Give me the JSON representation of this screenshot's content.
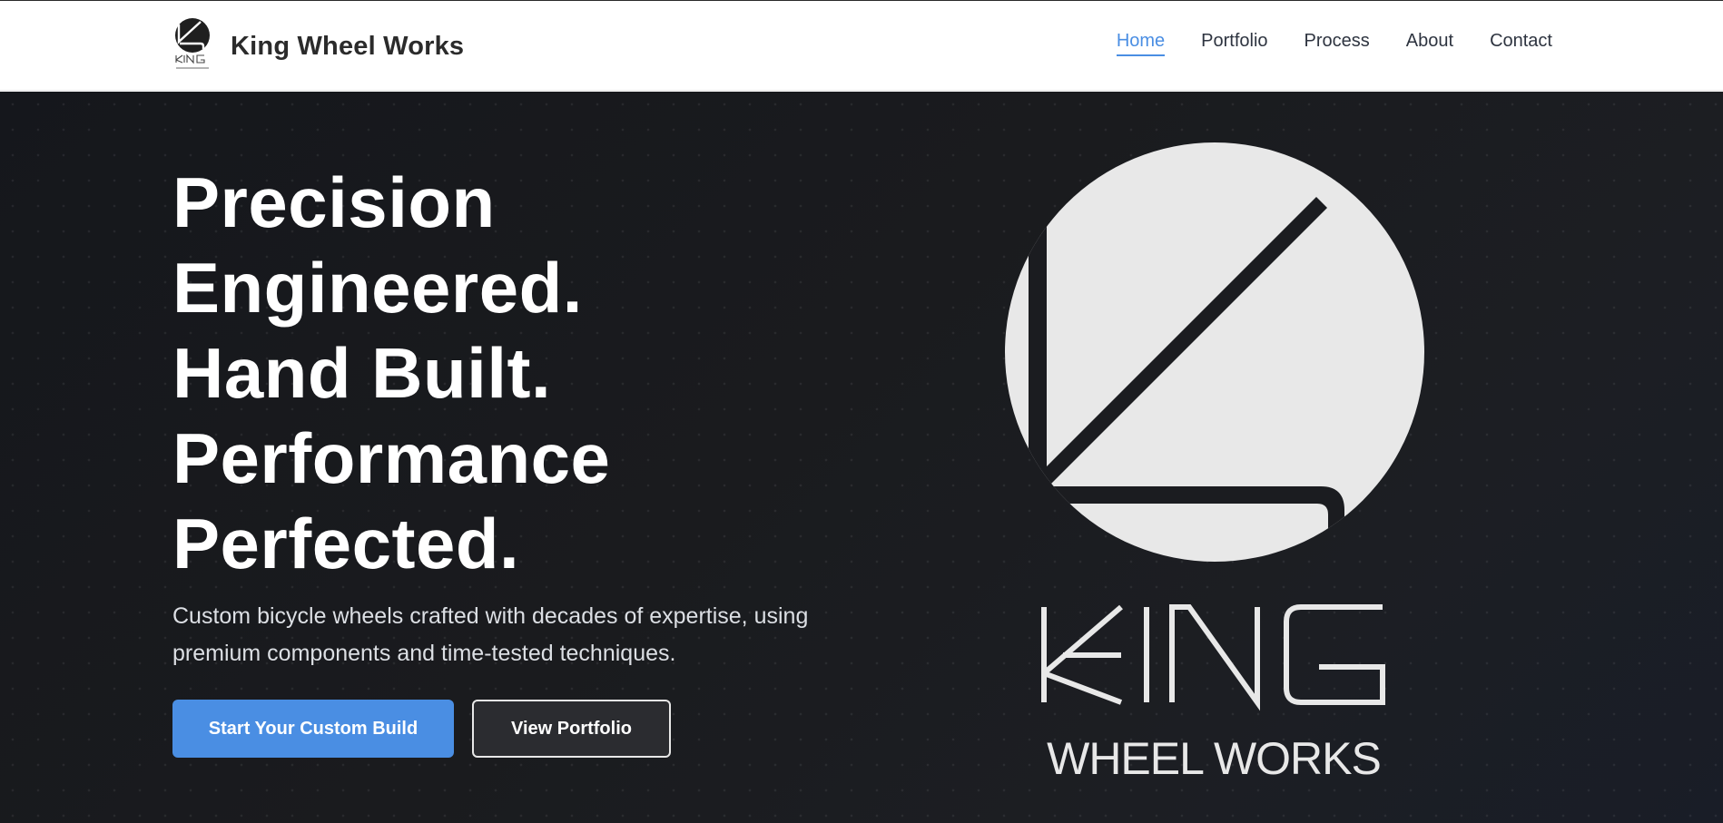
{
  "brand": {
    "name": "King Wheel Works",
    "logo_icon": "king-wheel-works-logo-icon"
  },
  "nav": {
    "items": [
      {
        "label": "Home",
        "active": true
      },
      {
        "label": "Portfolio",
        "active": false
      },
      {
        "label": "Process",
        "active": false
      },
      {
        "label": "About",
        "active": false
      },
      {
        "label": "Contact",
        "active": false
      }
    ]
  },
  "hero": {
    "title_lines": [
      "Precision",
      "Engineered.",
      "Hand Built.",
      "Performance",
      "Perfected."
    ],
    "description": "Custom bicycle wheels crafted with decades of expertise, using premium components and time-tested techniques.",
    "primary_button": "Start Your Custom Build",
    "secondary_button": "View Portfolio",
    "logo": {
      "wordmark": "KING",
      "subtitle": "WHEEL WORKS"
    }
  },
  "colors": {
    "accent": "#4a8ee3",
    "hero_background": "#1a1b1e",
    "logo_fill": "#e8e8e8",
    "heading": "#ffffff"
  }
}
